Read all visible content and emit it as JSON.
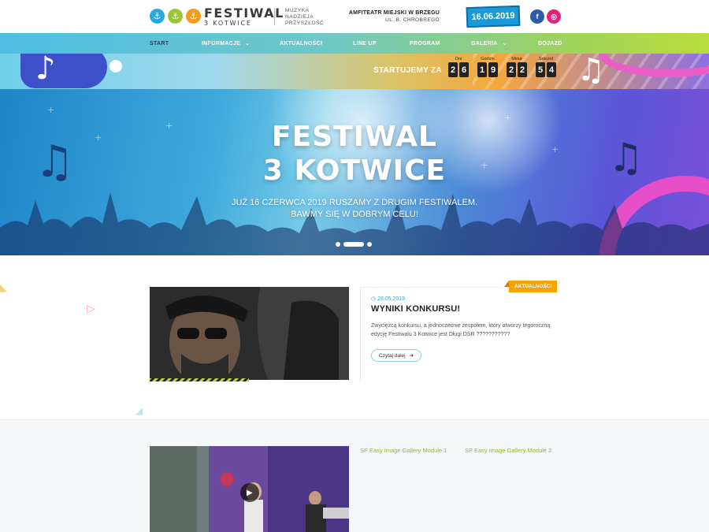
{
  "header": {
    "logo_title": "FESTIWAL",
    "logo_subtitle": "3 KOTWICE",
    "tagline": [
      "MUZYKA",
      "NADZIEJA",
      "PRZYSZŁOŚĆ"
    ],
    "venue_name": "AMFITEATR MIEJSKI W BRZEGU",
    "venue_street": "UL. B. CHROBREGO",
    "event_date": "16.06.2019",
    "social": [
      {
        "name": "facebook",
        "glyph": "f",
        "color": "#2d5ba8"
      },
      {
        "name": "instagram",
        "glyph": "◎",
        "color": "#e6207b"
      }
    ]
  },
  "nav": {
    "items": [
      {
        "label": "START",
        "active": true
      },
      {
        "label": "INFORMACJE",
        "has_submenu": true
      },
      {
        "label": "AKTUALNOŚCI"
      },
      {
        "label": "LINE UP"
      },
      {
        "label": "PROGRAM"
      },
      {
        "label": "GALERIA",
        "has_submenu": true
      },
      {
        "label": "DOJAZD"
      }
    ]
  },
  "countdown": {
    "label": "STARTUJEMY ZA",
    "units": [
      {
        "label": "Dni",
        "digits": [
          "2",
          "6"
        ]
      },
      {
        "label": "Godzin",
        "digits": [
          "1",
          "9"
        ]
      },
      {
        "label": "Minut",
        "digits": [
          "2",
          "2"
        ]
      },
      {
        "label": "Sekund",
        "digits": [
          "5",
          "4"
        ]
      }
    ]
  },
  "hero": {
    "title_line1": "FESTIWAL",
    "title_line2": "3 KOTWICE",
    "subtitle_line1": "JUŻ 16 CZERWCA 2019 RUSZAMY Z DRUGIM FESTIWALEM.",
    "subtitle_line2": "BAWMY SIĘ W DOBRYM CELU!",
    "slides_count": 3,
    "active_slide": 2
  },
  "news": {
    "category": "AKTUALNOŚCI",
    "date": "28.05.2019",
    "title": "WYNIKI KONKURSU!",
    "excerpt": "Zwycięzcą konkursu, a jednocześnie zespołem, który otworzy tegoroczną edycję Festiwalu 3 Kotwice jest Długi DSR ???????????",
    "read_more": "Czytaj dalej"
  },
  "gallery": {
    "module1": "SP Easy Image Gallery Module 1",
    "module2": "SP Easy Image Gallery Module 2"
  },
  "icons": {
    "date_icon": "◷",
    "read_more_arrow": "➔",
    "play": "▶",
    "caret": "⌄"
  },
  "colors": {
    "accent_blue": "#2aa9e0",
    "accent_green": "#9cc43b",
    "accent_orange": "#f5a300",
    "accent_pink": "#e6207b"
  }
}
